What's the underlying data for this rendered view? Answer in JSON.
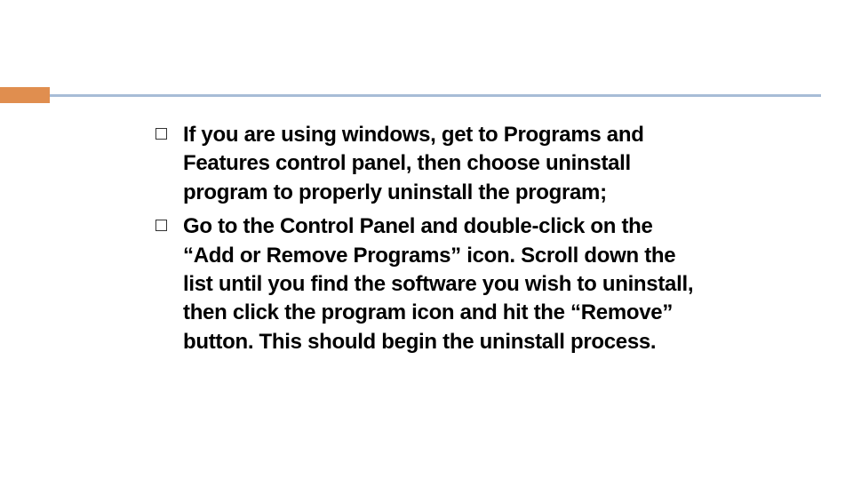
{
  "bullets": [
    {
      "text": "If you are using windows, get to Programs and Features control panel, then choose uninstall program to properly uninstall the program;"
    },
    {
      "text": "Go to the Control Panel and double-click on the “Add or Remove Programs” icon. Scroll down the list until you find the software you wish to uninstall, then click the program icon and hit the “Remove” button. This should begin the uninstall process."
    }
  ]
}
